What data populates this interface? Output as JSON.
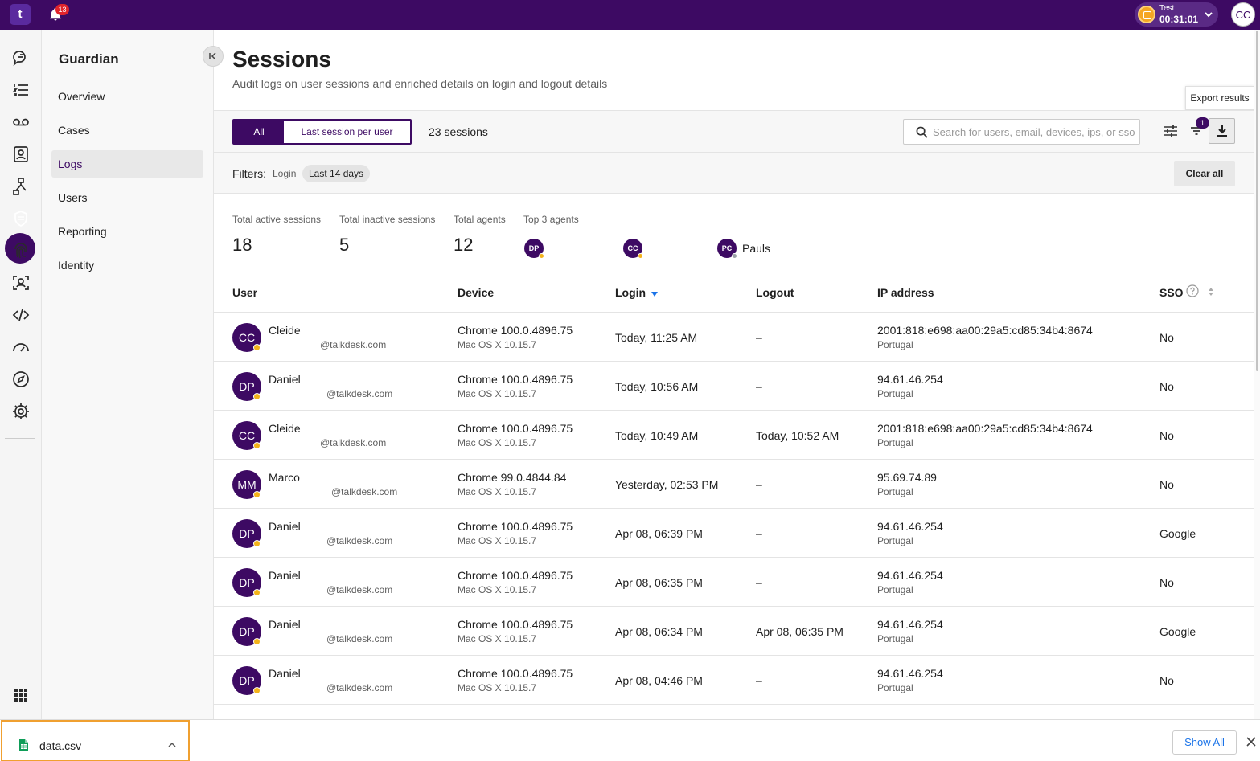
{
  "topbar": {
    "logo_text": "t",
    "notifications_count": "13",
    "status_label": "Test",
    "status_time": "00:31:01",
    "user_initials": "CC"
  },
  "rail": {
    "icons": [
      "conversations-icon",
      "list-icon",
      "voicemail-icon",
      "contacts-icon",
      "workflow-icon",
      "shield-icon",
      "fingerprint-icon",
      "identity-icon",
      "code-icon",
      "speedometer-icon",
      "compass-icon",
      "gear-icon",
      "apps-grid-icon"
    ],
    "active": "shield-icon"
  },
  "subnav": {
    "title": "Guardian",
    "items": [
      {
        "label": "Overview"
      },
      {
        "label": "Cases"
      },
      {
        "label": "Logs",
        "active": true
      },
      {
        "label": "Users"
      },
      {
        "label": "Reporting"
      },
      {
        "label": "Identity"
      }
    ]
  },
  "page": {
    "title": "Sessions",
    "subtitle": "Audit logs on user sessions and enriched details on login and logout details"
  },
  "tooltip": {
    "text": "Export results"
  },
  "toolbar": {
    "seg_all": "All",
    "seg_last": "Last session per user",
    "count": "23 sessions",
    "search_placeholder": "Search for users, email, devices, ips, or sso",
    "filter_badge": "1"
  },
  "filters": {
    "label": "Filters:",
    "login": "Login",
    "chip": "Last 14 days",
    "clear": "Clear all"
  },
  "metrics": {
    "active_label": "Total active sessions",
    "active_value": "18",
    "inactive_label": "Total inactive sessions",
    "inactive_value": "5",
    "agents_label": "Total agents",
    "agents_value": "12",
    "top_label": "Top 3 agents",
    "top_agents": [
      {
        "initials": "DP",
        "name": ""
      },
      {
        "initials": "CC",
        "name": ""
      },
      {
        "initials": "PC",
        "name": "Pauls"
      }
    ]
  },
  "table": {
    "headers": {
      "user": "User",
      "device": "Device",
      "login": "Login",
      "logout": "Logout",
      "ip": "IP address",
      "sso": "SSO"
    },
    "rows": [
      {
        "initials": "CC",
        "name": "Cleide",
        "email": "@talkdesk.com",
        "browser": "Chrome 100.0.4896.75",
        "os": "Mac OS X 10.15.7",
        "login": "Today, 11:25 AM",
        "logout": "–",
        "ip": "2001:818:e698:aa00:29a5:cd85:34b4:8674",
        "country": "Portugal",
        "sso": "No"
      },
      {
        "initials": "DP",
        "name": "Daniel",
        "email": "@talkdesk.com",
        "browser": "Chrome 100.0.4896.75",
        "os": "Mac OS X 10.15.7",
        "login": "Today, 10:56 AM",
        "logout": "–",
        "ip": "94.61.46.254",
        "country": "Portugal",
        "sso": "No"
      },
      {
        "initials": "CC",
        "name": "Cleide",
        "email": "@talkdesk.com",
        "browser": "Chrome 100.0.4896.75",
        "os": "Mac OS X 10.15.7",
        "login": "Today, 10:49 AM",
        "logout": "Today, 10:52 AM",
        "ip": "2001:818:e698:aa00:29a5:cd85:34b4:8674",
        "country": "Portugal",
        "sso": "No"
      },
      {
        "initials": "MM",
        "name": "Marco",
        "email": "@talkdesk.com",
        "browser": "Chrome 99.0.4844.84",
        "os": "Mac OS X 10.15.7",
        "login": "Yesterday, 02:53 PM",
        "logout": "–",
        "ip": "95.69.74.89",
        "country": "Portugal",
        "sso": "No"
      },
      {
        "initials": "DP",
        "name": "Daniel",
        "email": "@talkdesk.com",
        "browser": "Chrome 100.0.4896.75",
        "os": "Mac OS X 10.15.7",
        "login": "Apr 08, 06:39 PM",
        "logout": "–",
        "ip": "94.61.46.254",
        "country": "Portugal",
        "sso": "Google"
      },
      {
        "initials": "DP",
        "name": "Daniel",
        "email": "@talkdesk.com",
        "browser": "Chrome 100.0.4896.75",
        "os": "Mac OS X 10.15.7",
        "login": "Apr 08, 06:35 PM",
        "logout": "–",
        "ip": "94.61.46.254",
        "country": "Portugal",
        "sso": "No"
      },
      {
        "initials": "DP",
        "name": "Daniel",
        "email": "@talkdesk.com",
        "browser": "Chrome 100.0.4896.75",
        "os": "Mac OS X 10.15.7",
        "login": "Apr 08, 06:34 PM",
        "logout": "Apr 08, 06:35 PM",
        "ip": "94.61.46.254",
        "country": "Portugal",
        "sso": "Google"
      },
      {
        "initials": "DP",
        "name": "Daniel",
        "email": "@talkdesk.com",
        "browser": "Chrome 100.0.4896.75",
        "os": "Mac OS X 10.15.7",
        "login": "Apr 08, 04:46 PM",
        "logout": "–",
        "ip": "94.61.46.254",
        "country": "Portugal",
        "sso": "No"
      }
    ]
  },
  "download_bar": {
    "file_name": "data.csv",
    "show_all": "Show All"
  },
  "colors": {
    "brand": "#3d0a63",
    "status_dot": "#f3b31b",
    "badge": "#e1242c",
    "link": "#1a73e8",
    "highlight": "#f0a030"
  }
}
